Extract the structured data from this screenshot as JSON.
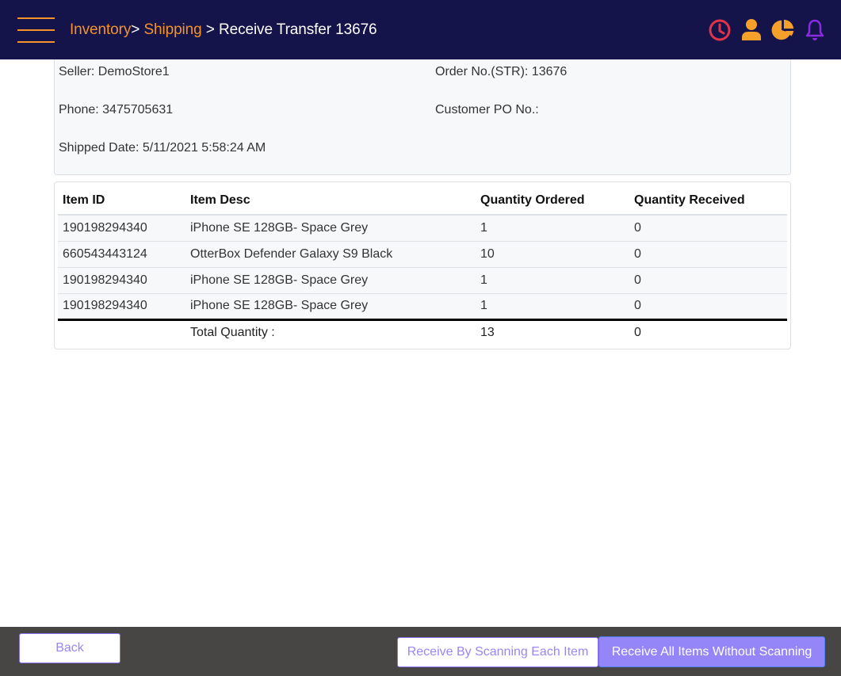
{
  "header": {
    "breadcrumb": [
      {
        "label": "Inventory",
        "link": true
      },
      {
        "label": "Shipping",
        "link": true
      },
      {
        "label": "Receive Transfer 13676",
        "link": false
      }
    ],
    "separator": ">",
    "icons": {
      "history": {
        "name": "clock-icon",
        "color": "#e0344a"
      },
      "user": {
        "name": "user-icon",
        "color": "#f5a02a"
      },
      "reports": {
        "name": "pie-chart-icon",
        "color": "#f5a02a"
      },
      "notifications": {
        "name": "bell-icon",
        "color": "#8a2be2"
      }
    },
    "accent_color": "#f5922a",
    "background_color": "#14144a"
  },
  "info": {
    "seller": "Seller: DemoStore1",
    "phone": "Phone: 3475705631",
    "shipped_date": "Shipped Date: 5/11/2021 5:58:24 AM",
    "order_no": "Order No.(STR): 13676",
    "customer_po": "Customer PO No.:"
  },
  "table": {
    "columns": [
      "Item ID",
      "Item Desc",
      "Quantity Ordered",
      "Quantity Received"
    ],
    "rows": [
      [
        "190198294340",
        "iPhone SE 128GB- Space Grey",
        "1",
        "0"
      ],
      [
        "660543443124",
        "OtterBox Defender Galaxy S9 Black",
        "10",
        "0"
      ],
      [
        "190198294340",
        "iPhone SE 128GB- Space Grey",
        "1",
        "0"
      ],
      [
        "190198294340",
        "iPhone SE 128GB- Space Grey",
        "1",
        "0"
      ]
    ],
    "total": {
      "label": "Total Quantity :",
      "ordered": "13",
      "received": "0"
    }
  },
  "footer": {
    "back_label": "Back",
    "scan_label": "Receive By Scanning Each Item",
    "noscan_label": "Receive All Items Without Scanning"
  }
}
